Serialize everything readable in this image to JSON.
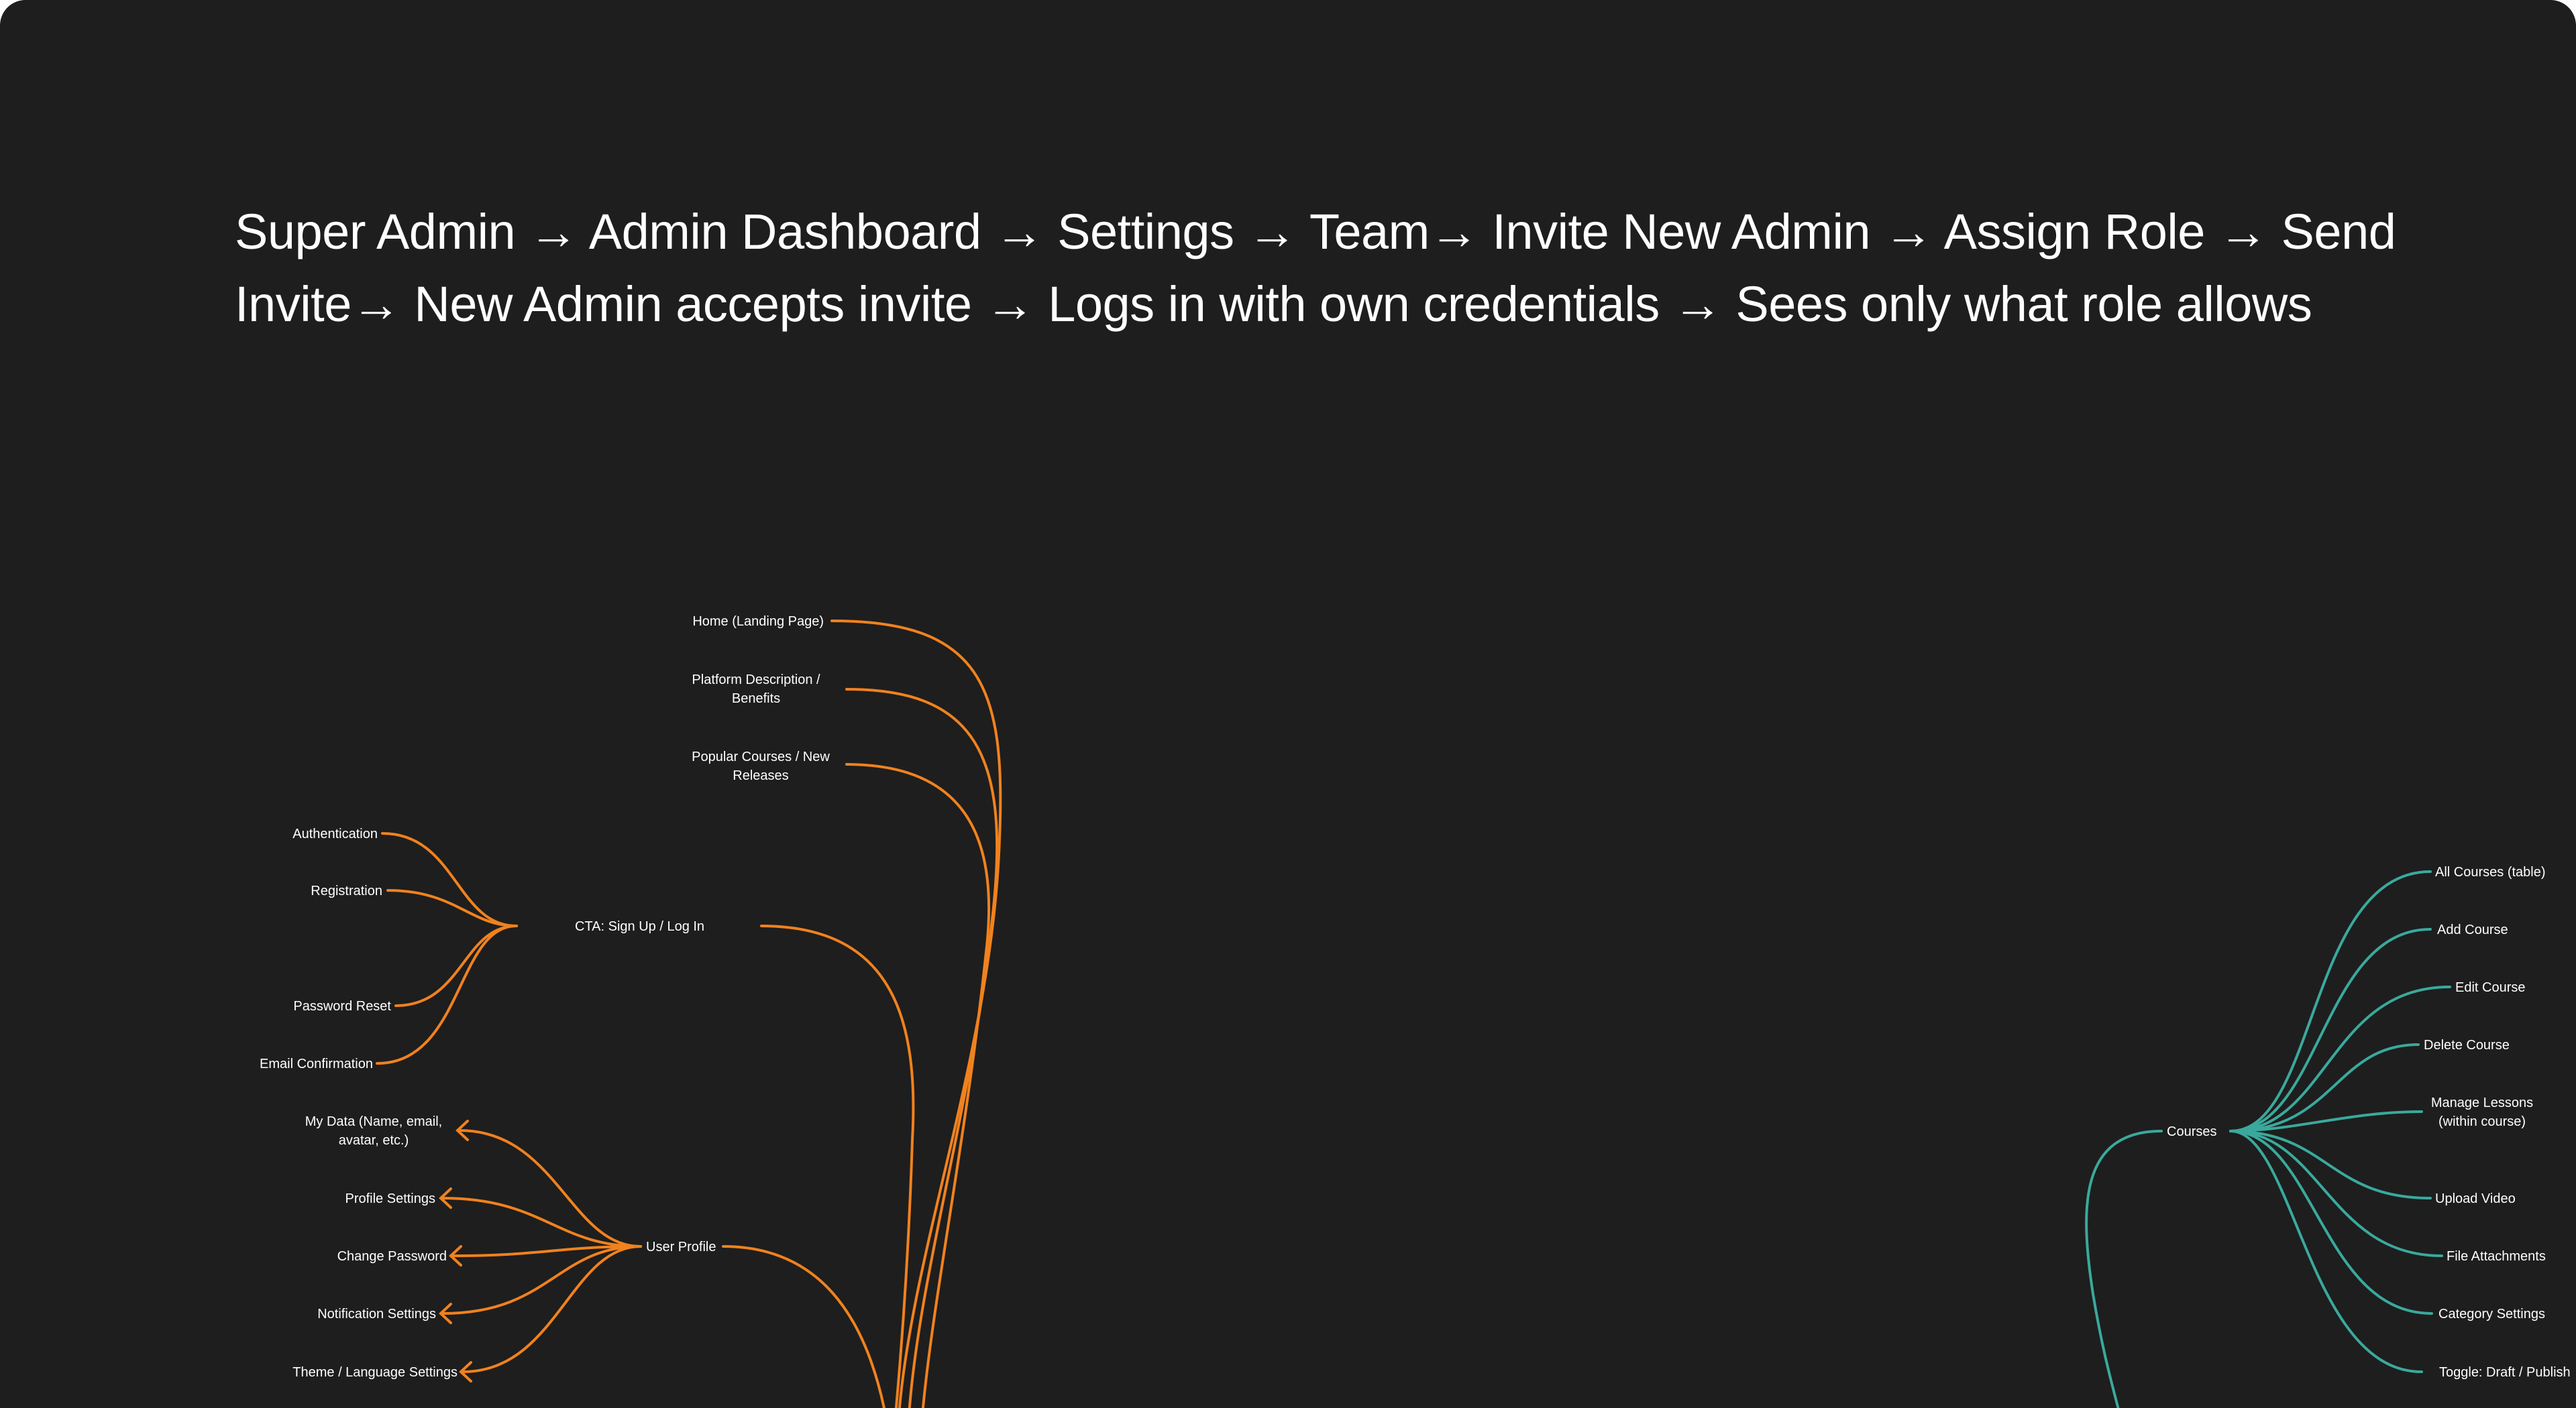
{
  "headline": {
    "line1": "Super Admin → Admin Dashboard → Settings → Team→ Invite New Admin → Assign Role → Send",
    "line2": "Invite→ New Admin accepts invite → Logs in with own credentials → Sees only what role allows"
  },
  "orange_map": {
    "top_nodes": {
      "home": "Home (Landing Page)",
      "platform": [
        "Platform Description /",
        "Benefits"
      ],
      "popular": [
        "Popular Courses / New",
        "Releases"
      ]
    },
    "cta": {
      "label": "CTA: Sign Up / Log In",
      "children": [
        "Authentication",
        "Registration",
        "Password Reset",
        "Email Confirmation"
      ]
    },
    "profile": {
      "label": "User Profile",
      "children": {
        "my_data": [
          "My Data (Name, email,",
          "avatar, etc.)"
        ],
        "profile_settings": "Profile Settings",
        "change_password": "Change Password",
        "notification_settings": "Notification Settings",
        "theme_language": "Theme / Language Settings"
      }
    }
  },
  "teal_map": {
    "courses": {
      "label": "Courses",
      "children": {
        "all_courses": "All Courses (table)",
        "add_course": "Add Course",
        "edit_course": "Edit Course",
        "delete_course": "Delete Course",
        "manage_lessons": [
          "Manage Lessons",
          "(within course)"
        ],
        "upload_video": "Upload Video",
        "file_attachments": "File Attachments",
        "category_settings": "Category Settings",
        "toggle_publish": "Toggle: Draft / Publish"
      }
    }
  },
  "colors": {
    "background": "#1e1e1e",
    "orange_branch": "#f0821e",
    "teal_branch": "#3aa99d",
    "text": "#ffffff"
  }
}
